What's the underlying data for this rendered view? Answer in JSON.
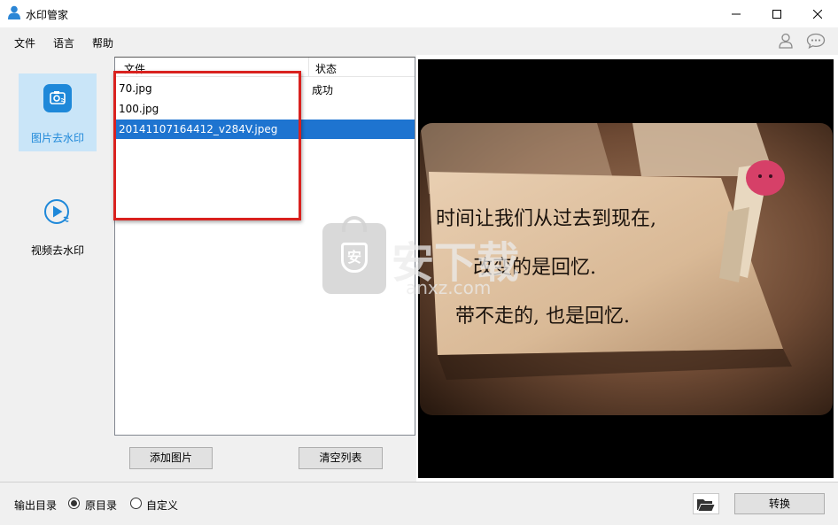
{
  "window": {
    "title": "水印管家",
    "minimize_icon": "minimize-icon",
    "maximize_icon": "maximize-icon",
    "close_icon": "close-icon"
  },
  "menu": {
    "file": "文件",
    "language": "语言",
    "help": "帮助",
    "user_icon": "user-icon",
    "chat_icon": "chat-icon"
  },
  "sidebar": {
    "items": [
      {
        "label": "图片去水印",
        "icon": "image-watermark-icon",
        "selected": true
      },
      {
        "label": "视频去水印",
        "icon": "video-watermark-icon",
        "selected": false
      }
    ]
  },
  "file_list": {
    "columns": [
      "文件",
      "状态"
    ],
    "rows": [
      {
        "name": "70.jpg",
        "status": "成功",
        "selected": false
      },
      {
        "name": "100.jpg",
        "status": "",
        "selected": false
      },
      {
        "name": "20141107164412_v284V.jpeg",
        "status": "",
        "selected": true
      }
    ],
    "add_button": "添加图片",
    "clear_button": "清空列表"
  },
  "preview": {
    "handwriting_lines": [
      "时间让我们从过去到现在,",
      "改变的是回忆.",
      "带不走的, 也是回忆."
    ],
    "watermark_text": "安下载",
    "watermark_sub": "anxz.com"
  },
  "bottom": {
    "output_dir_label": "输出目录",
    "option_original": "原目录",
    "option_custom": "自定义",
    "selected_option": "原目录",
    "folder_icon": "folder-open-icon",
    "convert_button": "转换"
  },
  "colors": {
    "selection_blue": "#1e74d0",
    "nav_selected_bg": "#c9e5f8",
    "nav_icon_blue": "#1e88d9",
    "annotation_red": "#d9211e"
  }
}
